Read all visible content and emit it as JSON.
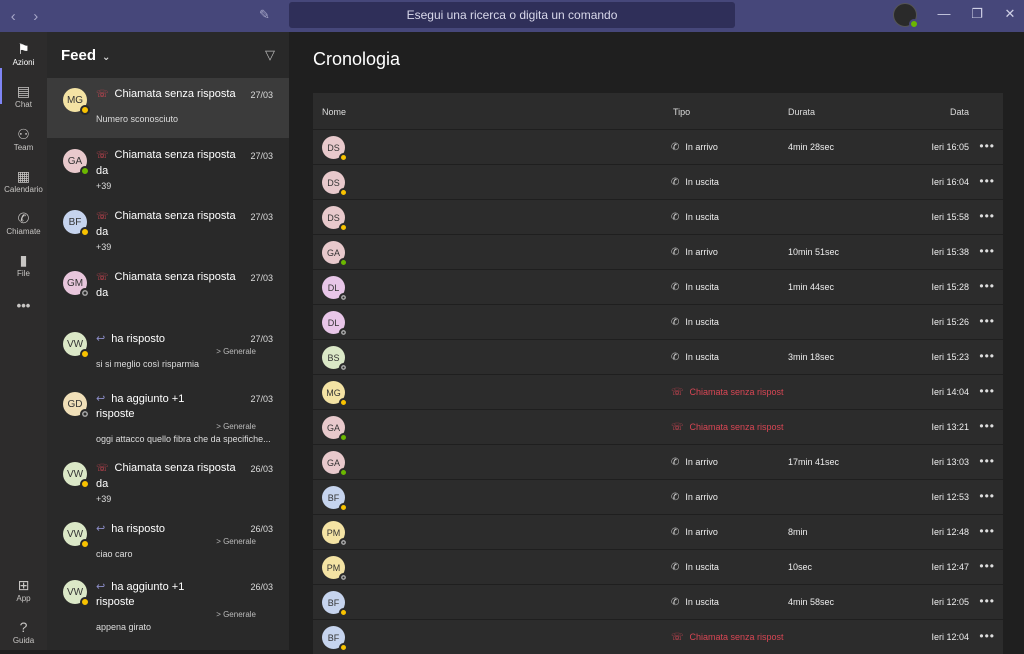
{
  "titlebar": {
    "back_icon": "‹",
    "forward_icon": "›",
    "search_placeholder": "Esegui una ricerca o digita un comando",
    "minimize_icon": "—",
    "maximize_icon": "❐",
    "close_icon": "✕"
  },
  "rail": {
    "items": [
      {
        "label": "Azioni",
        "icon": "bell-icon",
        "glyph": "🔔"
      },
      {
        "label": "Chat",
        "icon": "chat-icon",
        "glyph": "▤"
      },
      {
        "label": "Team",
        "icon": "team-icon",
        "glyph": "⚇"
      },
      {
        "label": "Calendario",
        "icon": "calendar-icon",
        "glyph": "▦"
      },
      {
        "label": "Chiamate",
        "icon": "phone-icon",
        "glyph": "✆"
      },
      {
        "label": "File",
        "icon": "file-icon",
        "glyph": "▮"
      },
      {
        "label": "•••",
        "icon": "more-icon",
        "glyph": ""
      },
      {
        "label": "App",
        "icon": "apps-icon",
        "glyph": "⊞"
      },
      {
        "label": "Guida",
        "icon": "help-icon",
        "glyph": "?"
      }
    ]
  },
  "feed": {
    "title": "Feed",
    "items": [
      {
        "initials": "MG",
        "avatar_color": "#f4e3a4",
        "status": "yellow",
        "kind": "missed",
        "title": "Chiamata senza risposta",
        "date": "27/03",
        "line2": "",
        "line3": "Numero sconosciuto",
        "sub": ""
      },
      {
        "initials": "GA",
        "avatar_color": "#e8c9cc",
        "status": "green",
        "kind": "missed",
        "title": "Chiamata senza risposta",
        "date": "27/03",
        "line2": "da",
        "line3": "+39",
        "sub": ""
      },
      {
        "initials": "BF",
        "avatar_color": "#c6d4ee",
        "status": "yellow",
        "kind": "missed",
        "title": "Chiamata senza risposta",
        "date": "27/03",
        "line2": "da",
        "line3": "+39",
        "sub": ""
      },
      {
        "initials": "GM",
        "avatar_color": "#e8c6dc",
        "status": "grey",
        "kind": "missed",
        "title": "Chiamata senza risposta",
        "date": "27/03",
        "line2": "da",
        "line3": "",
        "sub": ""
      },
      {
        "initials": "VW",
        "avatar_color": "#dbe8c7",
        "status": "yellow",
        "kind": "reply",
        "title": "ha risposto",
        "date": "27/03",
        "line2": "",
        "line3": "si si meglio così risparmia",
        "sub": "> Generale"
      },
      {
        "initials": "GD",
        "avatar_color": "#f0dfb8",
        "status": "grey",
        "kind": "reply",
        "title": "ha aggiunto +1",
        "date": "27/03",
        "line2": "risposte",
        "line3": "oggi attacco quello fibra che da specifiche...",
        "sub": "> Generale"
      },
      {
        "initials": "VW",
        "avatar_color": "#dbe8c7",
        "status": "yellow",
        "kind": "missed",
        "title": "Chiamata senza risposta",
        "date": "26/03",
        "line2": "da",
        "line3": "+39",
        "sub": ""
      },
      {
        "initials": "VW",
        "avatar_color": "#dbe8c7",
        "status": "yellow",
        "kind": "reply",
        "title": "ha risposto",
        "date": "26/03",
        "line2": "",
        "line3": "ciao caro",
        "sub": "> Generale"
      },
      {
        "initials": "VW",
        "avatar_color": "#dbe8c7",
        "status": "yellow",
        "kind": "reply",
        "title": "ha aggiunto +1",
        "date": "26/03",
        "line2": "risposte",
        "line3": "appena girato",
        "sub": "> Generale"
      }
    ]
  },
  "main": {
    "title": "Cronologia",
    "columns": {
      "nome": "Nome",
      "tipo": "Tipo",
      "durata": "Durata",
      "data": "Data"
    },
    "rows": [
      {
        "initials": "DS",
        "avatar_color": "#e8c9cc",
        "status": "yellow",
        "tipo": "In arrivo",
        "missed": false,
        "durata": "4min 28sec",
        "data": "Ieri 16:05"
      },
      {
        "initials": "DS",
        "avatar_color": "#e8c9cc",
        "status": "yellow",
        "tipo": "In uscita",
        "missed": false,
        "durata": "",
        "data": "Ieri 16:04"
      },
      {
        "initials": "DS",
        "avatar_color": "#e8c9cc",
        "status": "yellow",
        "tipo": "In uscita",
        "missed": false,
        "durata": "",
        "data": "Ieri 15:58"
      },
      {
        "initials": "GA",
        "avatar_color": "#e8c9cc",
        "status": "green",
        "tipo": "In arrivo",
        "missed": false,
        "durata": "10min 51sec",
        "data": "Ieri 15:38"
      },
      {
        "initials": "DL",
        "avatar_color": "#e8c6e8",
        "status": "grey",
        "tipo": "In uscita",
        "missed": false,
        "durata": "1min 44sec",
        "data": "Ieri 15:28"
      },
      {
        "initials": "DL",
        "avatar_color": "#e8c6e8",
        "status": "grey",
        "tipo": "In uscita",
        "missed": false,
        "durata": "",
        "data": "Ieri 15:26"
      },
      {
        "initials": "BS",
        "avatar_color": "#dbe8c7",
        "status": "grey",
        "tipo": "In uscita",
        "missed": false,
        "durata": "3min 18sec",
        "data": "Ieri 15:23"
      },
      {
        "initials": "MG",
        "avatar_color": "#f4e3a4",
        "status": "yellow",
        "tipo": "Chiamata senza rispost",
        "missed": true,
        "durata": "",
        "data": "Ieri 14:04"
      },
      {
        "initials": "GA",
        "avatar_color": "#e8c9cc",
        "status": "green",
        "tipo": "Chiamata senza rispost",
        "missed": true,
        "durata": "",
        "data": "Ieri 13:21"
      },
      {
        "initials": "GA",
        "avatar_color": "#e8c9cc",
        "status": "green",
        "tipo": "In arrivo",
        "missed": false,
        "durata": "17min 41sec",
        "data": "Ieri 13:03"
      },
      {
        "initials": "BF",
        "avatar_color": "#c6d4ee",
        "status": "yellow",
        "tipo": "In arrivo",
        "missed": false,
        "durata": "",
        "data": "Ieri 12:53"
      },
      {
        "initials": "PM",
        "avatar_color": "#f4e3a4",
        "status": "grey",
        "tipo": "In arrivo",
        "missed": false,
        "durata": "8min",
        "data": "Ieri 12:48"
      },
      {
        "initials": "PM",
        "avatar_color": "#f4e3a4",
        "status": "grey",
        "tipo": "In uscita",
        "missed": false,
        "durata": "10sec",
        "data": "Ieri 12:47"
      },
      {
        "initials": "BF",
        "avatar_color": "#c6d4ee",
        "status": "yellow",
        "tipo": "In uscita",
        "missed": false,
        "durata": "4min 58sec",
        "data": "Ieri 12:05"
      },
      {
        "initials": "BF",
        "avatar_color": "#c6d4ee",
        "status": "yellow",
        "tipo": "Chiamata senza rispost",
        "missed": true,
        "durata": "",
        "data": "Ieri 12:04"
      }
    ]
  }
}
